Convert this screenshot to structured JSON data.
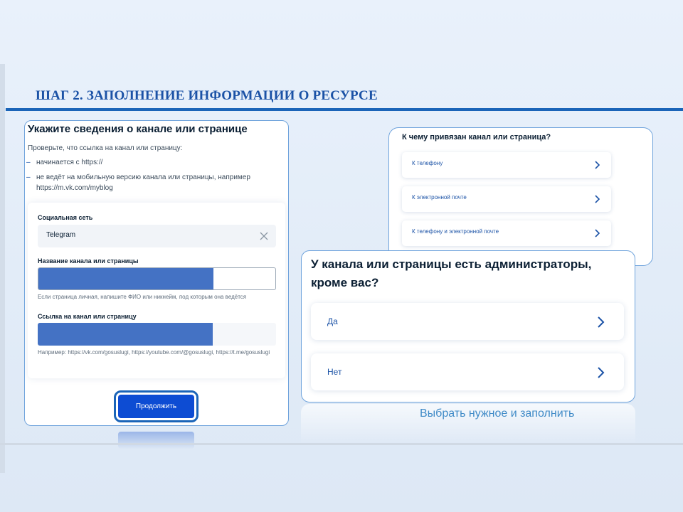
{
  "heading": "ШАГ 2. ЗАПОЛНЕНИЕ ИНФОРМАЦИИ О РЕСУРСЕ",
  "form": {
    "title": "Укажите сведения о канале или странице",
    "intro": "Проверьте, что ссылка на канал или страницу:",
    "bullets": [
      "начинается с https://",
      "не ведёт на мобильную версию канала или страницы, например https://m.vk.com/myblog"
    ],
    "bullet_marker": "–",
    "social_label": "Социальная сеть",
    "social_value": "Telegram",
    "name_label": "Название канала или страницы",
    "name_hint": "Если страница личная, напишите ФИО или никнейм, под которым она ведётся",
    "link_label": "Ссылка на канал или страницу",
    "link_hint": "Например: https://vk.com/gosuslugi, https://youtube.com/@gosuslugi, https://t.me/gosuslugi",
    "continue_label": "Продолжить"
  },
  "bind": {
    "title": "К чему привязан канал или страница?",
    "options": [
      "К телефону",
      "К электронной почте",
      "К телефону и электронной почте"
    ]
  },
  "admin": {
    "question": "У канала или страницы есть администраторы, кроме вас?",
    "options": [
      "Да",
      "Нет"
    ]
  },
  "caption": "Выбрать нужное и заполнить",
  "colors": {
    "accent": "#1b52a6",
    "primary_button": "#0d4cd3",
    "heading_rule": "#1a64b8",
    "redaction": "#4472c4",
    "caption": "#3f8ac7"
  },
  "icons": {
    "clear": "close-icon",
    "chevron": "chevron-right-icon"
  }
}
